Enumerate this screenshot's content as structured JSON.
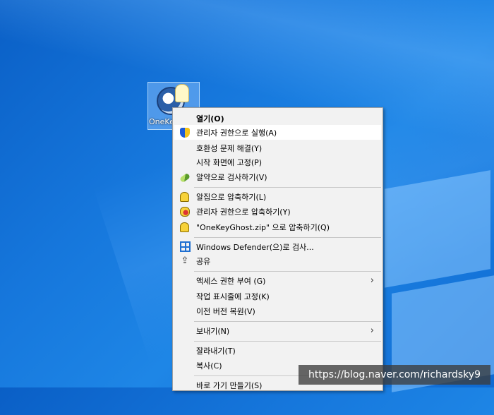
{
  "desktop_icon": {
    "label": "OneKey"
  },
  "menu": {
    "items": [
      {
        "label": "열기(O)"
      },
      {
        "label": "관리자 권한으로 실행(A)"
      },
      {
        "label": "호환성 문제 해결(Y)"
      },
      {
        "label": "시작 화면에 고정(P)"
      },
      {
        "label": "알약으로 검사하기(V)"
      },
      {
        "label": "알집으로 압축하기(L)"
      },
      {
        "label": "관리자 권한으로 압축하기(Y)"
      },
      {
        "label": "\"OneKeyGhost.zip\" 으로 압축하기(Q)"
      },
      {
        "label": "Windows Defender(으)로 검사..."
      },
      {
        "label": "공유"
      },
      {
        "label": "액세스 권한 부여 (G)"
      },
      {
        "label": "작업 표시줄에 고정(K)"
      },
      {
        "label": "이전 버전 복원(V)"
      },
      {
        "label": "보내기(N)"
      },
      {
        "label": "잘라내기(T)"
      },
      {
        "label": "복사(C)"
      },
      {
        "label": "바로 가기 만들기(S)"
      }
    ],
    "submenu_arrow": "›",
    "share_icon_glyph": "⇪"
  },
  "watermark": {
    "text": "https://blog.naver.com/richardsky9"
  },
  "colors": {
    "desktop": "#1677dc",
    "menu_bg": "#f2f2f2",
    "highlight": "#ffffff"
  }
}
